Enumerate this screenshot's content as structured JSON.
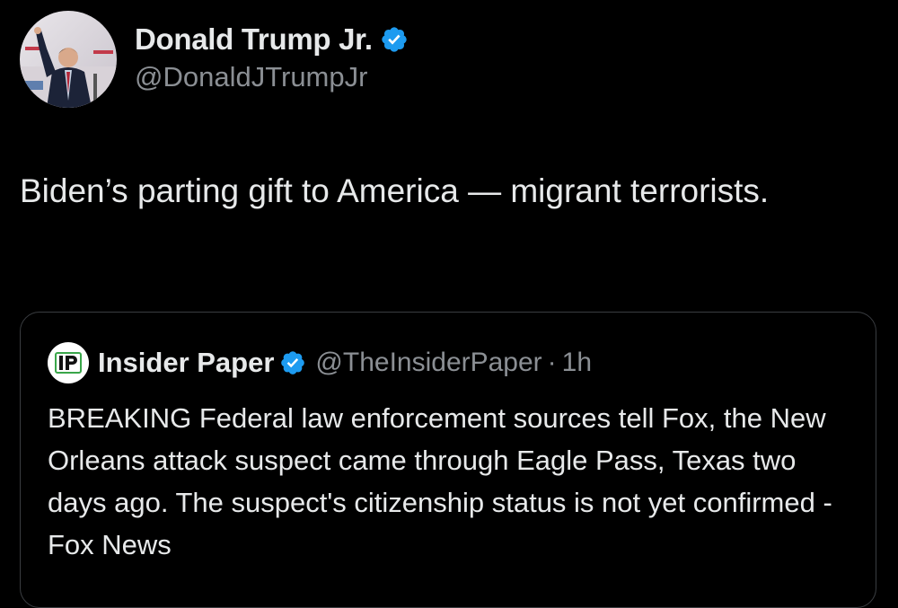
{
  "tweet": {
    "author": {
      "display_name": "Donald Trump Jr.",
      "handle": "@DonaldJTrumpJr",
      "avatar_icon": "profile-photo",
      "verified_icon": "verified-badge-icon",
      "verified_color": "#1d9bf0"
    },
    "text": "Biden’s parting gift to America — migrant terrorists.",
    "quote": {
      "author": {
        "display_name": "Insider Paper",
        "handle": "@TheInsiderPaper",
        "avatar_logo_text": "IP",
        "verified_icon": "verified-badge-icon"
      },
      "separator": "·",
      "time": "1h",
      "text": "BREAKING Federal law enforcement sources tell Fox, the New Orleans attack suspect came through Eagle Pass, Texas two days ago. The suspect's citizenship status is not yet confirmed - Fox News"
    }
  },
  "colors": {
    "background": "#000000",
    "text_primary": "#e7e9ea",
    "text_secondary": "#8b8f94",
    "card_border": "#3a3d41",
    "verified_blue": "#1d9bf0",
    "logo_green": "#3aa64a"
  }
}
